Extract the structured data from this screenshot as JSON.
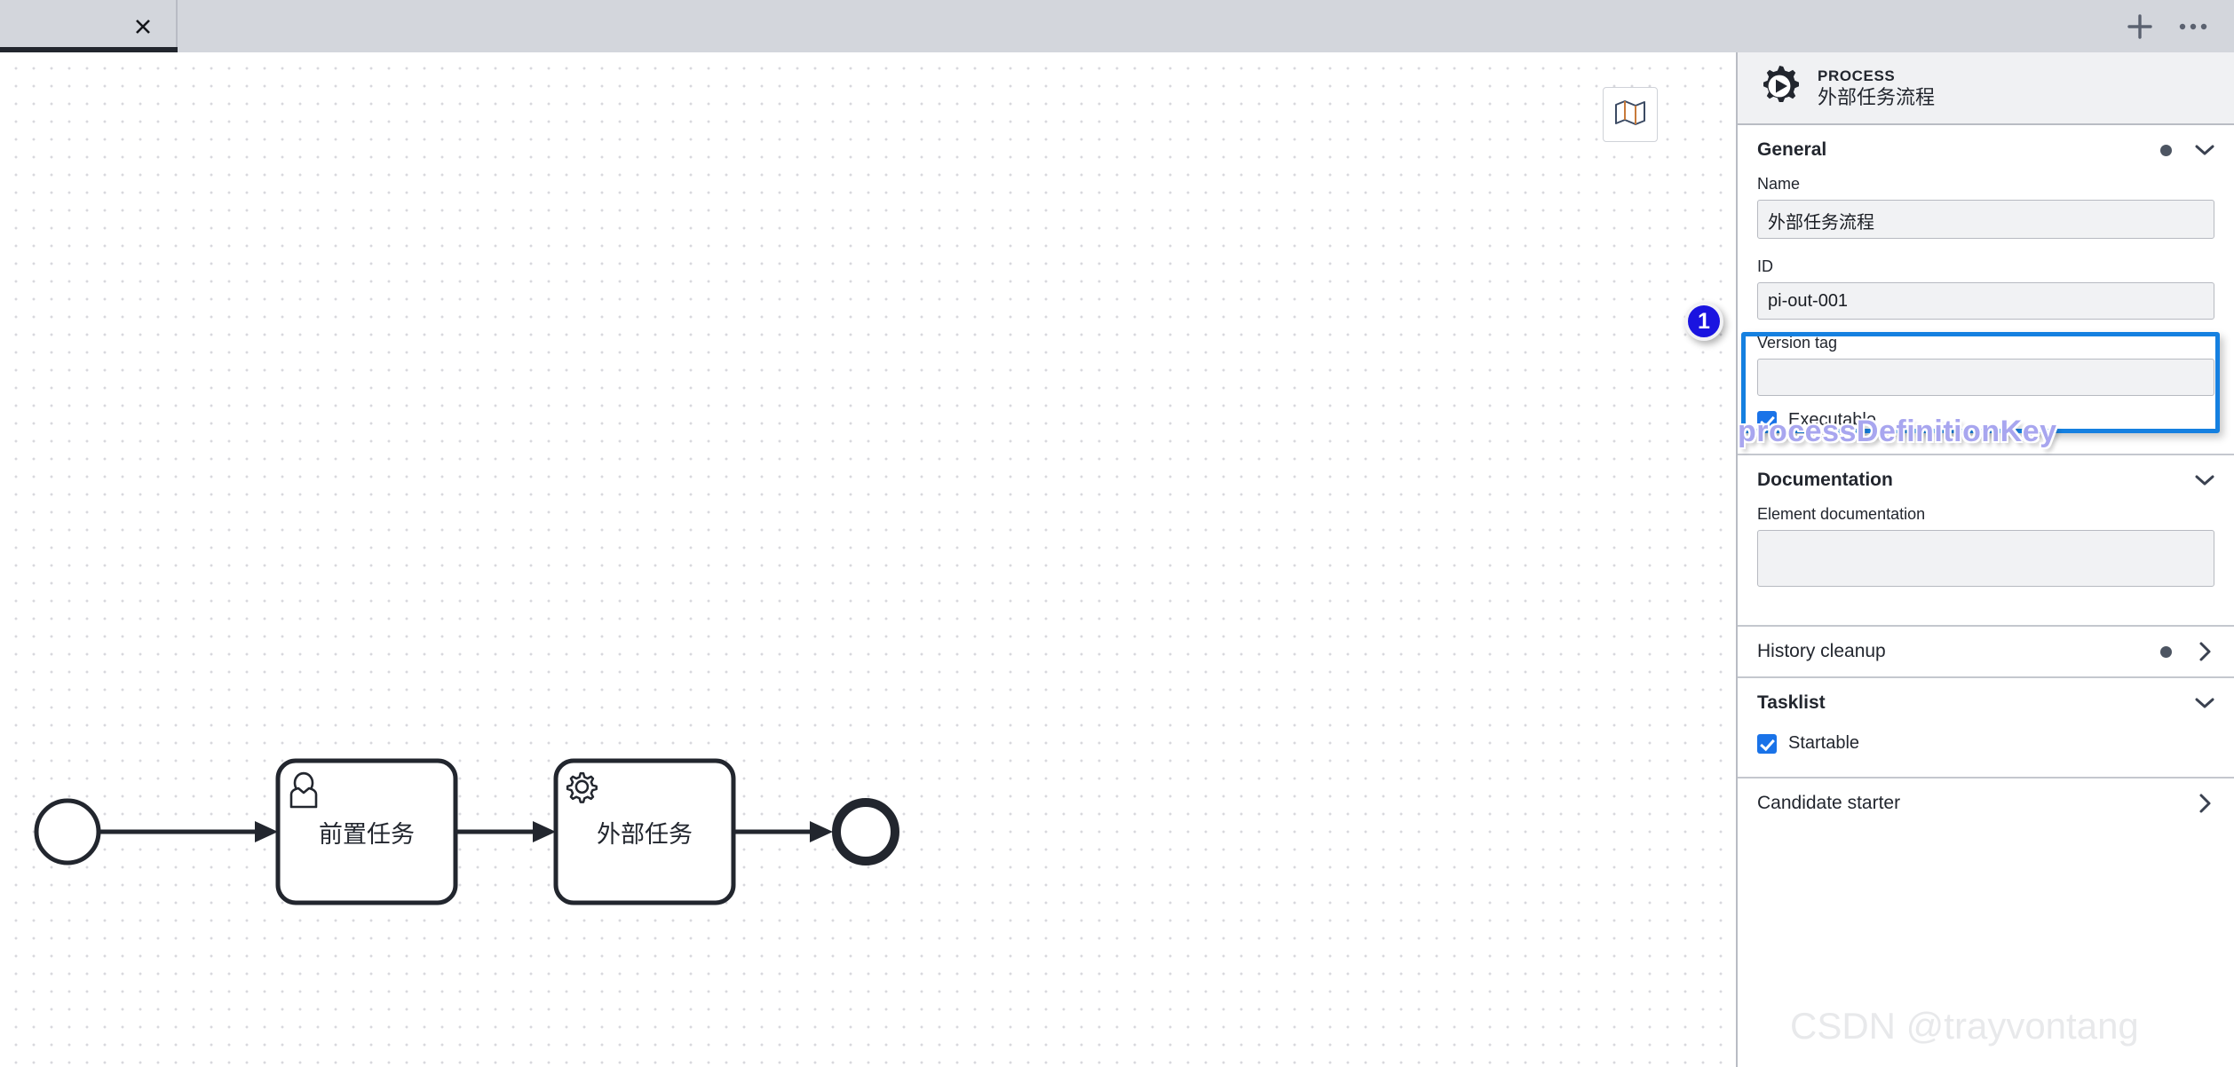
{
  "tabbar": {
    "tab_close_icon": "close-icon",
    "add_tab_label": "+",
    "more_label": "⋯",
    "tab_title": ""
  },
  "canvas": {
    "minimap_icon": "map-icon",
    "diagram": {
      "start_event": {
        "name": "",
        "type": "start-event"
      },
      "tasks": [
        {
          "label": "前置任务",
          "type": "user-task",
          "icon": "user-icon"
        },
        {
          "label": "外部任务",
          "type": "service-task",
          "icon": "gear-icon"
        }
      ],
      "end_event": {
        "name": "",
        "type": "end-event"
      }
    }
  },
  "panel": {
    "header": {
      "icon": "process-gear-play-icon",
      "type": "PROCESS",
      "name": "外部任务流程"
    },
    "groups": {
      "general": {
        "title": "General",
        "name_label": "Name",
        "name_value": "外部任务流程",
        "id_label": "ID",
        "id_value": "pi-out-001",
        "version_tag_label": "Version tag",
        "version_tag_value": "",
        "executable_label": "Executable",
        "executable_checked": true
      },
      "documentation": {
        "title": "Documentation",
        "element_doc_label": "Element documentation",
        "element_doc_value": ""
      },
      "history_cleanup": {
        "title": "History cleanup"
      },
      "tasklist": {
        "title": "Tasklist",
        "startable_label": "Startable",
        "startable_checked": true
      },
      "candidate_starter": {
        "title": "Candidate starter"
      }
    }
  },
  "annotation": {
    "badge_number": "1",
    "label": "processDefinitionKey",
    "accent_color": "#1580e0",
    "badge_color": "#1a14e0",
    "label_color": "#a8a6ef"
  },
  "watermark": {
    "text": "CSDN @trayvontang"
  }
}
